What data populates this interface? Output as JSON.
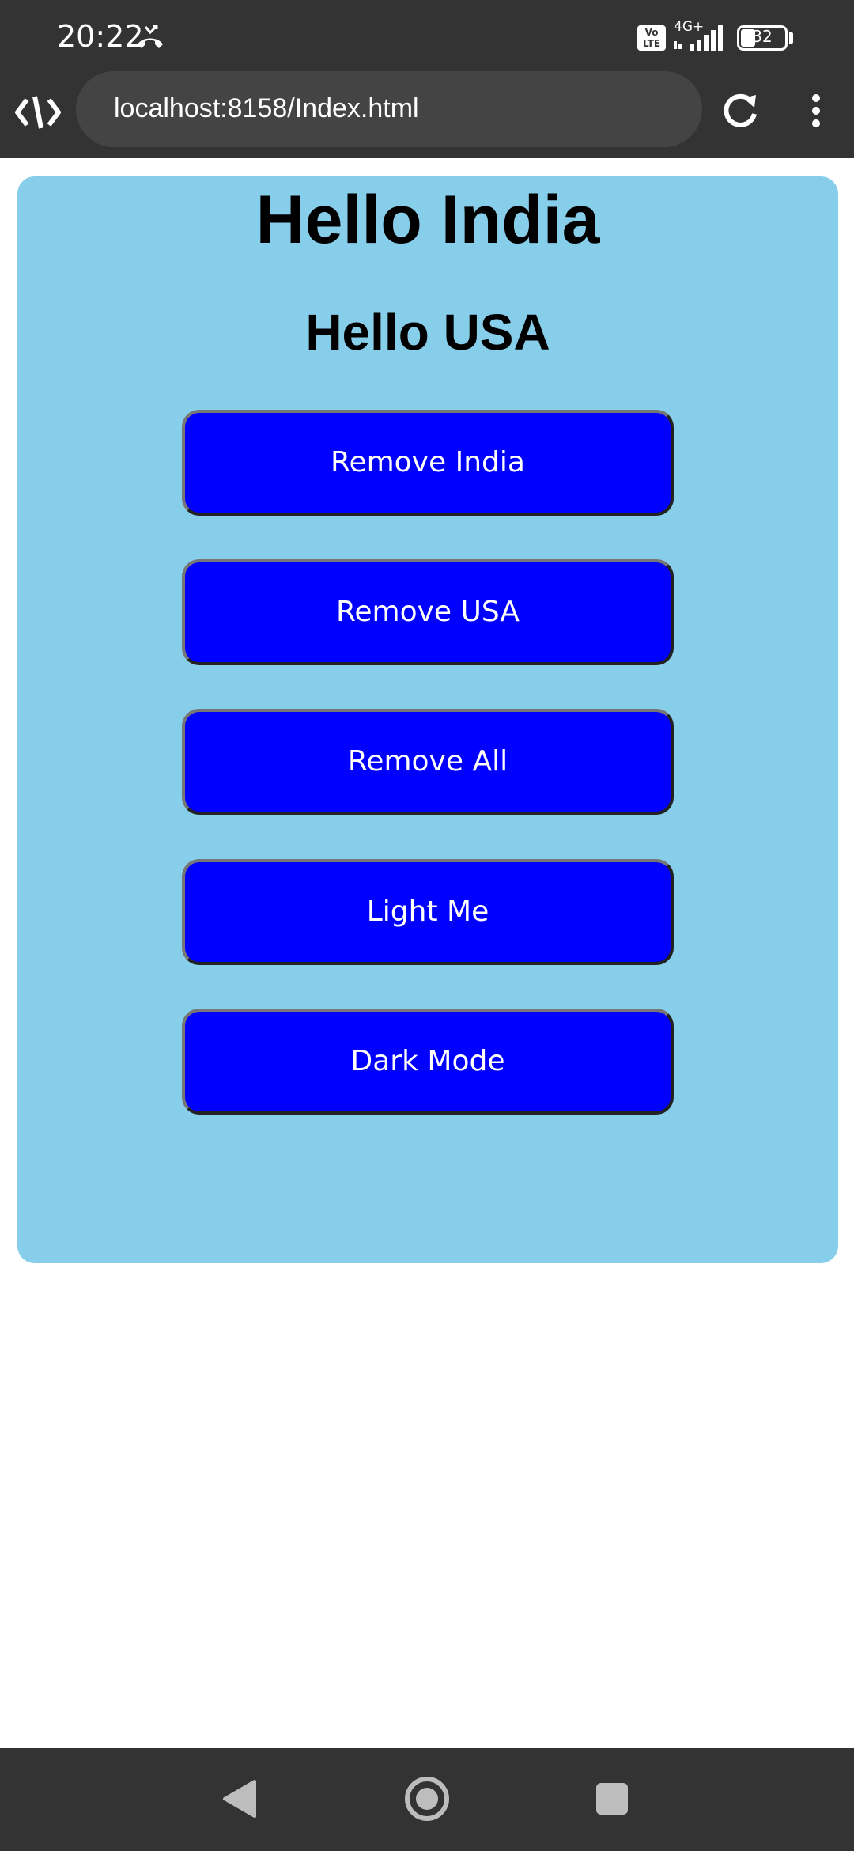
{
  "status_bar": {
    "time": "20:22",
    "volte_label": "Vo\nLTE",
    "network_label": "4G+",
    "battery_level": "32",
    "icons": [
      "missed-call-icon",
      "volte-icon",
      "signal-icon",
      "battery-icon"
    ]
  },
  "browser": {
    "url": "localhost:8158/Index.html",
    "icons": [
      "code-app-icon",
      "reload-icon",
      "more-vert-icon"
    ]
  },
  "page": {
    "heading1": "Hello India",
    "heading2": "Hello USA",
    "background_color": "#87ceeb",
    "buttons": [
      {
        "label": "Remove India"
      },
      {
        "label": "Remove USA"
      },
      {
        "label": "Remove All"
      },
      {
        "label": "Light Me"
      },
      {
        "label": "Dark Mode"
      }
    ],
    "button_color": "#0000ff"
  },
  "nav_bar": {
    "icons": [
      "back-icon",
      "home-icon",
      "recents-icon"
    ]
  }
}
